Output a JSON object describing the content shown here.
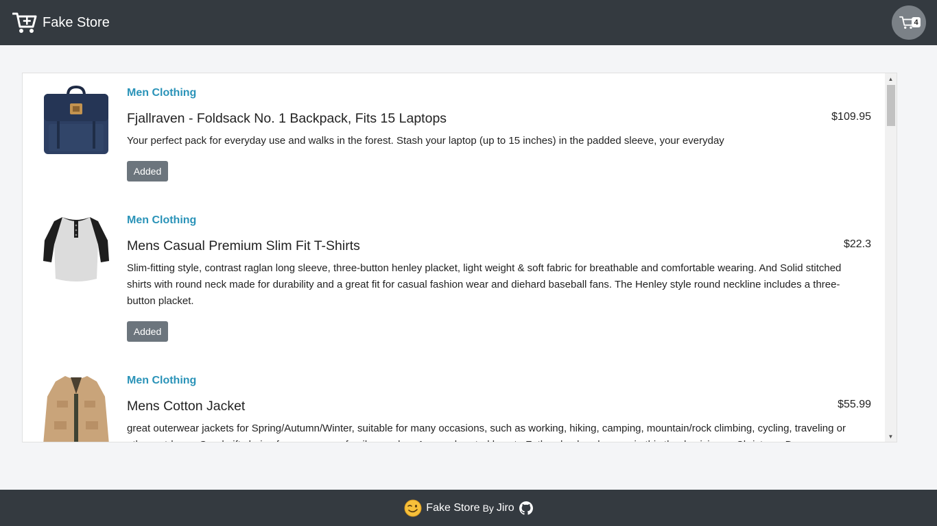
{
  "header": {
    "brand": "Fake Store",
    "cart_count": "4"
  },
  "products": [
    {
      "category": "Men Clothing",
      "title": "Fjallraven - Foldsack No. 1 Backpack, Fits 15 Laptops",
      "price": "$109.95",
      "description": "Your perfect pack for everyday use and walks in the forest. Stash your laptop (up to 15 inches) in the padded sleeve, your everyday",
      "button": "Added"
    },
    {
      "category": "Men Clothing",
      "title": "Mens Casual Premium Slim Fit T-Shirts",
      "price": "$22.3",
      "description": "Slim-fitting style, contrast raglan long sleeve, three-button henley placket, light weight & soft fabric for breathable and comfortable wearing. And Solid stitched shirts with round neck made for durability and a great fit for casual fashion wear and diehard baseball fans. The Henley style round neckline includes a three-button placket.",
      "button": "Added"
    },
    {
      "category": "Men Clothing",
      "title": "Mens Cotton Jacket",
      "price": "$55.99",
      "description": "great outerwear jackets for Spring/Autumn/Winter, suitable for many occasions, such as working, hiking, camping, mountain/rock climbing, cycling, traveling or other outdoors. Good gift choice for you or your family member. A warm hearted love to Father, husband or son in this thanksgiving or Christmas Day."
    }
  ],
  "footer": {
    "text": "Fake Store",
    "by": "By",
    "author": "Jiro"
  },
  "icons": {
    "brand": "cart-plus-icon",
    "cart": "shopping-cart-icon",
    "footer_emoji": "wink-emoji-icon",
    "github": "github-icon"
  }
}
